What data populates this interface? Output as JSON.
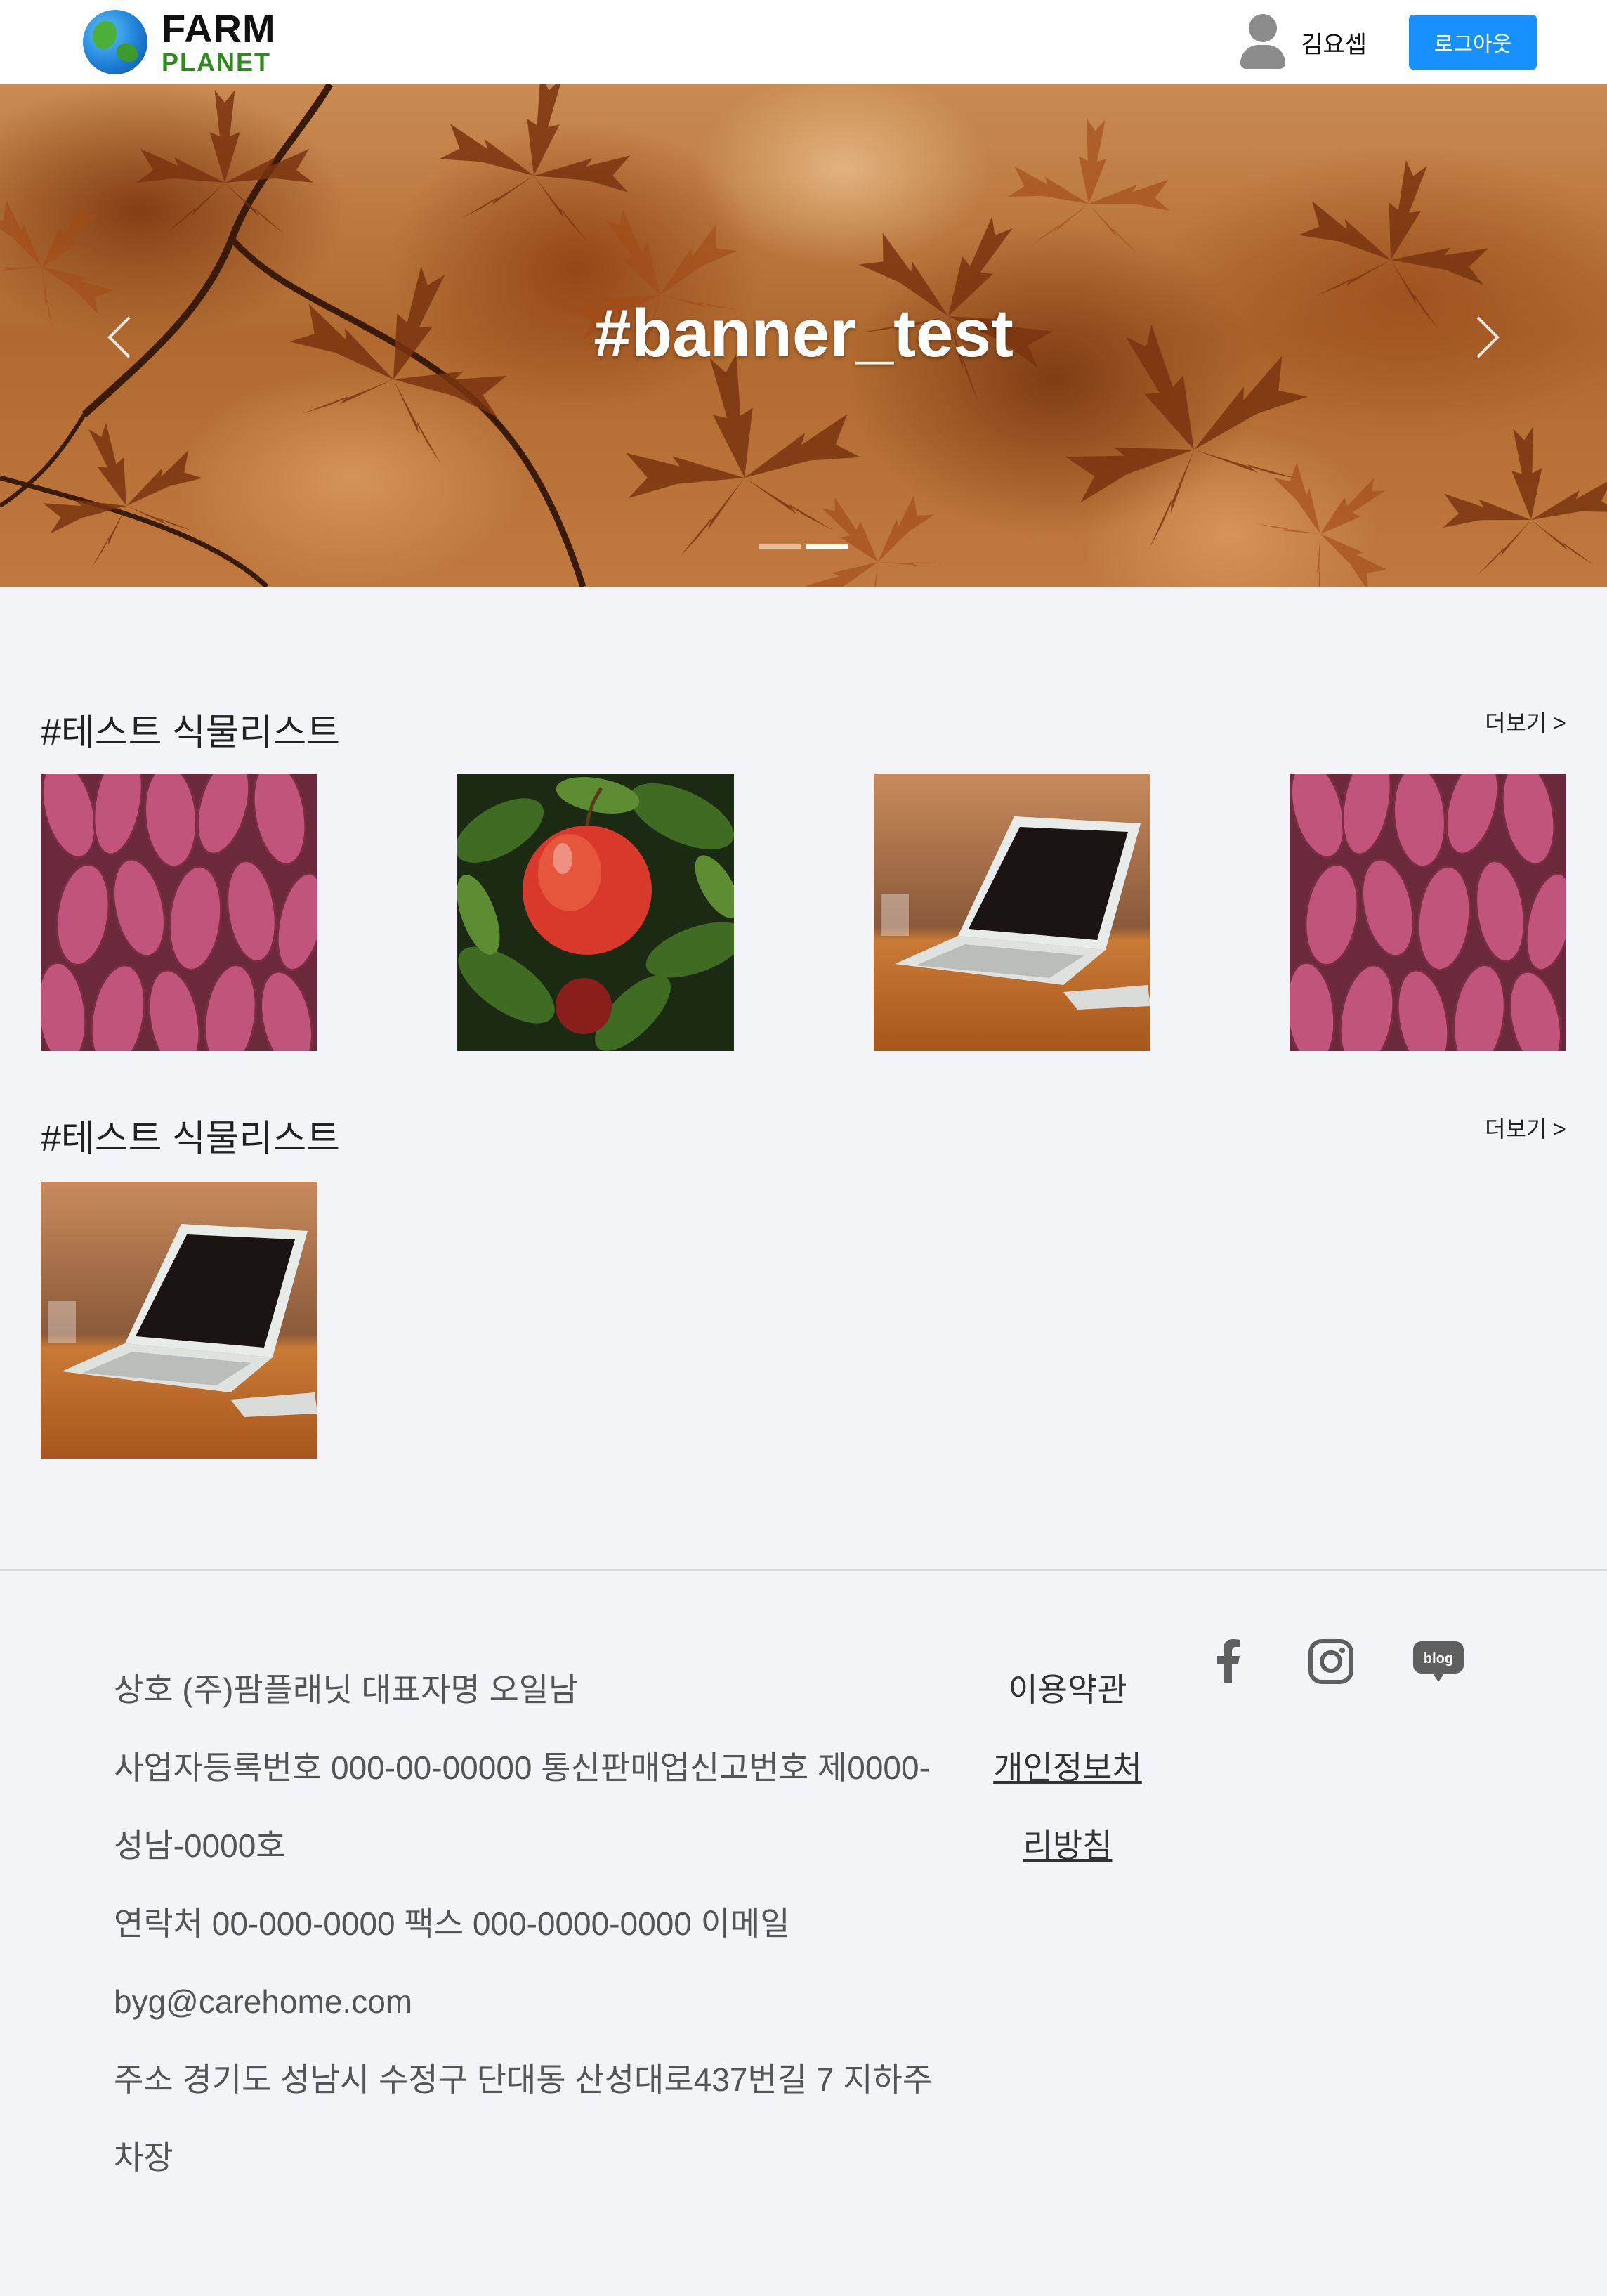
{
  "header": {
    "logo_top": "FARM",
    "logo_bottom": "PLANET",
    "username": "김요셉",
    "logout_label": "로그아웃"
  },
  "banner": {
    "title": "#banner_test",
    "active_slide": 2,
    "slide_count": 2
  },
  "sections": [
    {
      "title": "#테스트 식물리스트",
      "more_label": "더보기 >",
      "items": [
        "sweet-potato-photo",
        "apple-photo",
        "laptop-photo",
        "sweet-potato-photo"
      ]
    },
    {
      "title": "#테스트 식물리스트",
      "more_label": "더보기 >",
      "items": [
        "laptop-photo"
      ]
    }
  ],
  "footer": {
    "info_lines": [
      "상호 (주)팜플래닛 대표자명 오일남",
      "사업자등록번호 000-00-00000 통신판매업신고번호 제0000-",
      "성남-0000호",
      "연락처 00-000-0000 팩스 000-0000-0000 이메일",
      "byg@carehome.com",
      "주소 경기도 성남시 수정구 단대동 산성대로437번길 7 지하주",
      "차장"
    ],
    "terms_label": "이용약관",
    "privacy_label_1": "개인정보처",
    "privacy_label_2": "리방침",
    "social_icons": [
      "facebook-icon",
      "instagram-icon",
      "blog-icon"
    ],
    "blog_icon_text": "blog"
  }
}
